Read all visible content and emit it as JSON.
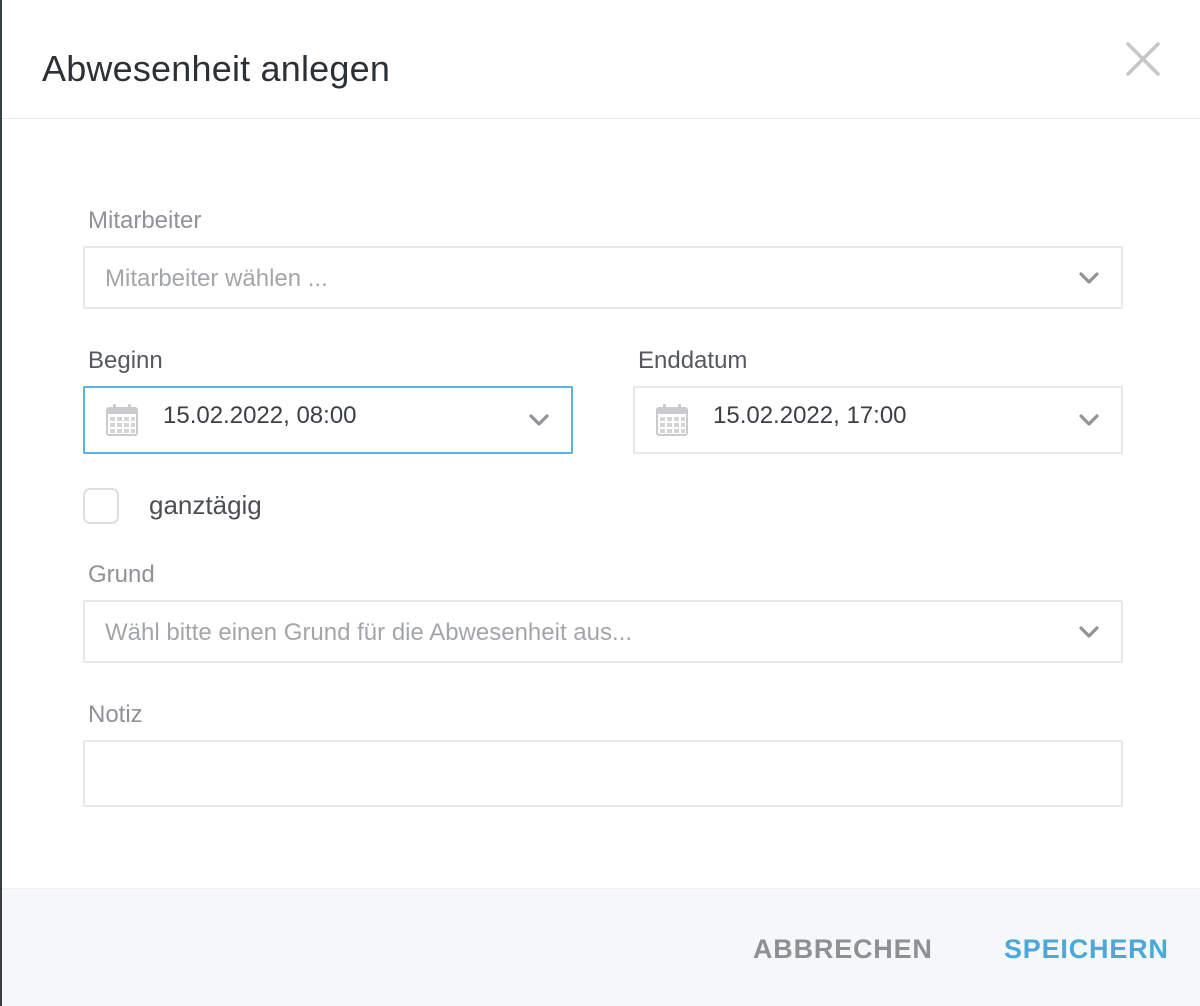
{
  "dialog": {
    "title": "Abwesenheit anlegen"
  },
  "form": {
    "employee": {
      "label": "Mitarbeiter",
      "placeholder": "Mitarbeiter wählen ..."
    },
    "start": {
      "label": "Beginn",
      "value": "15.02.2022, 08:00"
    },
    "end": {
      "label": "Enddatum",
      "value": "15.02.2022, 17:00"
    },
    "all_day": {
      "label": "ganztägig",
      "checked": false
    },
    "reason": {
      "label": "Grund",
      "placeholder": "Wähl bitte einen Grund für die Abwesenheit aus..."
    },
    "note": {
      "label": "Notiz",
      "value": ""
    }
  },
  "footer": {
    "cancel_label": "ABBRECHEN",
    "save_label": "SPEICHERN"
  },
  "colors": {
    "accent": "#4aa8db",
    "focus_border": "#5fb2dc",
    "muted_text": "#8f9296"
  },
  "icons": [
    "close-icon",
    "calendar-icon",
    "chevron-down-icon"
  ]
}
